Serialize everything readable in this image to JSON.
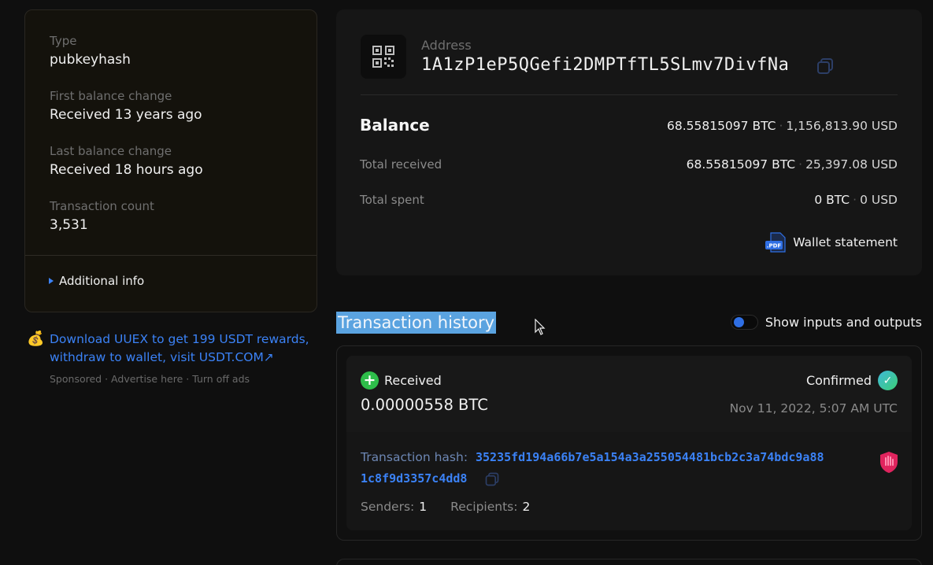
{
  "address_info": {
    "type_label": "Type",
    "type_value": "pubkeyhash",
    "first_change_label": "First balance change",
    "first_change_value": "Received 13 years ago",
    "last_change_label": "Last balance change",
    "last_change_value": "Received 18 hours ago",
    "tx_count_label": "Transaction count",
    "tx_count_value": "3,531",
    "additional_info": "Additional info"
  },
  "ad": {
    "icon": "money-bag-icon",
    "text": "Download UUEX to get 199 USDT rewards, withdraw to wallet, visit USDT.COM↗",
    "sponsored": "Sponsored",
    "advertise": "Advertise here",
    "turn_off": "Turn off ads",
    "separator": "·"
  },
  "address_card": {
    "label": "Address",
    "value": "1A1zP1eP5QGefi2DMPTfTL5SLmv7DivfNa",
    "qr_icon": "qr-code-icon",
    "balance_title": "Balance",
    "balance_btc": "68.55815097 BTC",
    "balance_usd": "1,156,813.90 USD",
    "total_received_label": "Total received",
    "total_received_btc": "68.55815097 BTC",
    "total_received_usd": "25,397.08 USD",
    "total_spent_label": "Total spent",
    "total_spent_btc": "0 BTC",
    "total_spent_usd": "0 USD",
    "wallet_statement": "Wallet statement",
    "pdf_label": ".PDF"
  },
  "history": {
    "title": "Transaction history",
    "toggle_label": "Show inputs and outputs",
    "toggle_on": false
  },
  "transactions": [
    {
      "direction": "Received",
      "amount": "0.00000558 BTC",
      "status": "Confirmed",
      "date": "Nov 11, 2022, 5:07 AM UTC",
      "hash_label": "Transaction hash:",
      "hash_line1": "35235fd194a66b7e5a154a3a255054481bcb2c3a74bdc9a88",
      "hash_line2": "1c8f9d3357c4dd8",
      "senders_label": "Senders:",
      "senders": "1",
      "recipients_label": "Recipients:",
      "recipients": "2"
    }
  ],
  "colors": {
    "accent": "#3b82f6",
    "background": "#0f0f0f",
    "card": "#161616",
    "received_green": "#2ebd4a",
    "highlight": "#5aa3e0"
  }
}
